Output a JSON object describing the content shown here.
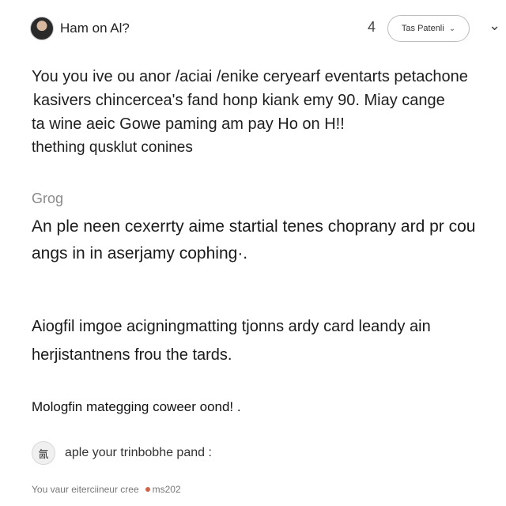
{
  "header": {
    "username": "Ham on Al?",
    "glyph": "4",
    "pill_label": "Tas Patenli",
    "pill_chevron": "⌄",
    "chevron": "⌄"
  },
  "intro": {
    "lines": [
      "You you ive ou anor /aciai /enike ceryearf eventarts petachone",
      "kasivers chincercea's fand honp kiank emy 90. Miay cange",
      "ta wine aeic Gowe paming am pay Ho on H!!",
      "thething qusklut conines"
    ]
  },
  "section": {
    "label": "Grog",
    "para1": [
      "An ple neen cexerrty aime startial tenes choprany ard pr cou",
      "angs in in aserjamy cophing·."
    ],
    "para2": [
      "Aiogfil imgoe acigningmatting tjonns ardy card leandy ain",
      "herjistantnens frou the tards."
    ],
    "para3": "Mologfin mategging coweer oond! ."
  },
  "reply": {
    "avatar_glyph": "氤",
    "text": "aple your trinbobhe pand :"
  },
  "footer": {
    "text": "You vaur eiterciineur cree",
    "suffix": "ms202"
  }
}
